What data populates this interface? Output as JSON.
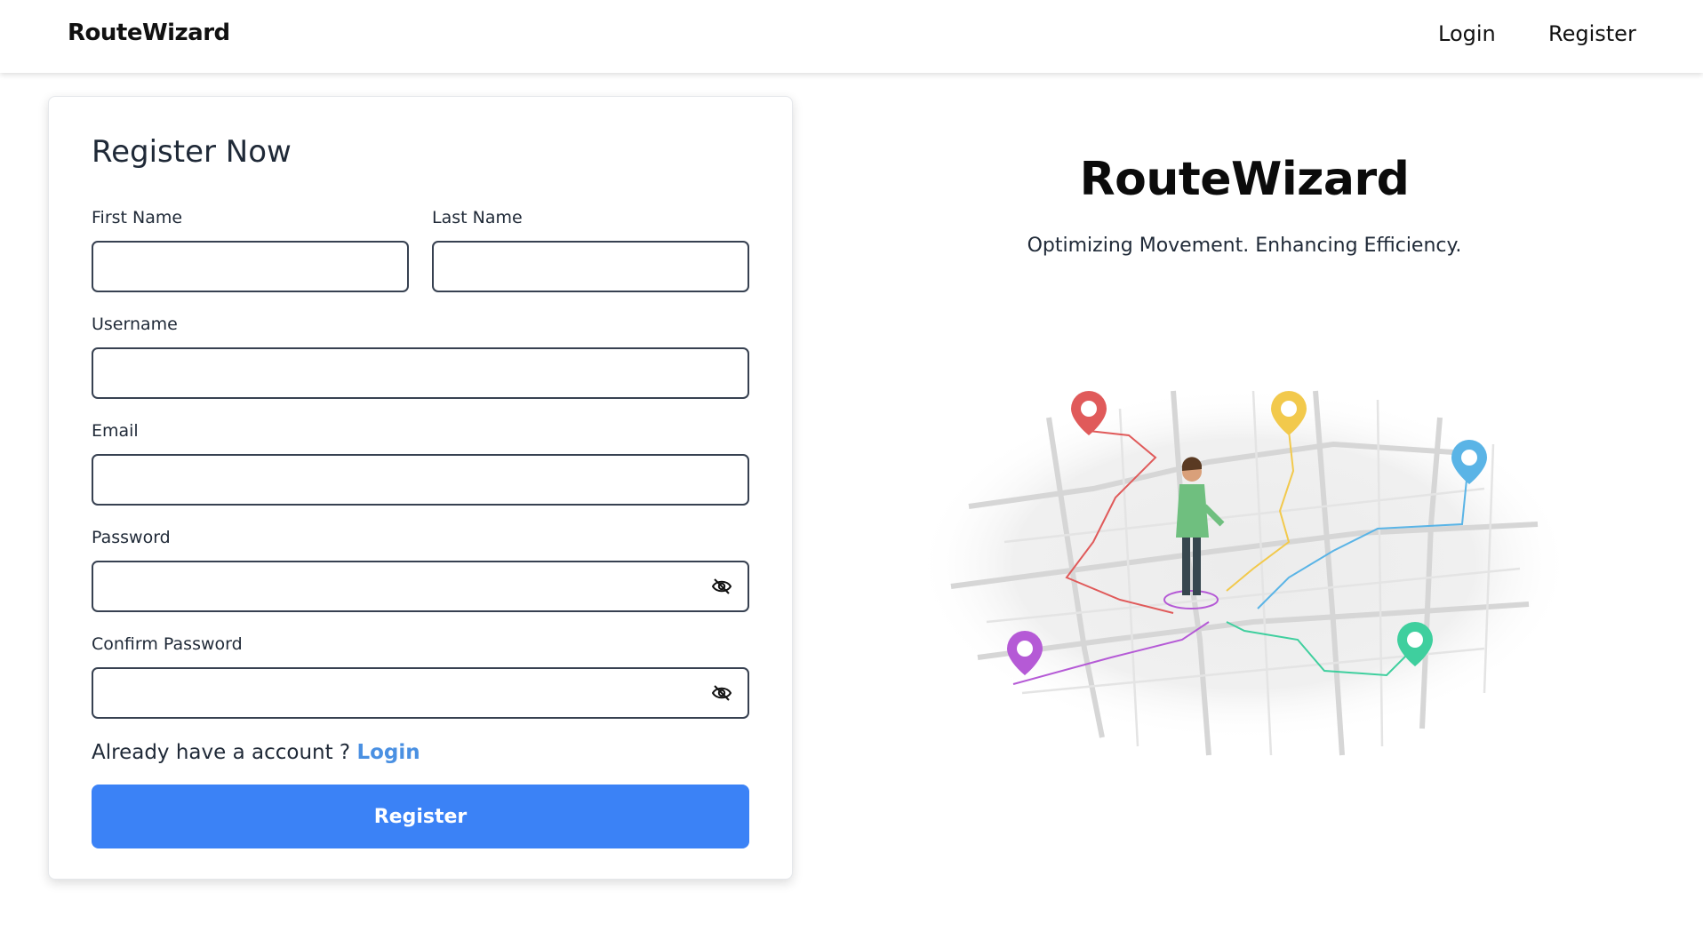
{
  "nav": {
    "brand": "RouteWizard",
    "links": {
      "login": "Login",
      "register": "Register"
    }
  },
  "form": {
    "title": "Register Now",
    "fields": {
      "first_name": {
        "label": "First Name",
        "value": ""
      },
      "last_name": {
        "label": "Last Name",
        "value": ""
      },
      "username": {
        "label": "Username",
        "value": ""
      },
      "email": {
        "label": "Email",
        "value": ""
      },
      "password": {
        "label": "Password",
        "value": ""
      },
      "confirm_password": {
        "label": "Confirm Password",
        "value": ""
      }
    },
    "already_text": "Already have a account ?",
    "login_link": "Login",
    "submit_label": "Register"
  },
  "hero": {
    "title": "RouteWizard",
    "subtitle": "Optimizing Movement. Enhancing Efficiency."
  },
  "illustration": {
    "pins": [
      {
        "icon": "map-pin-icon",
        "color": "#e05a5a"
      },
      {
        "icon": "map-pin-icon",
        "color": "#f2c94c"
      },
      {
        "icon": "map-pin-icon",
        "color": "#5ab4e6"
      },
      {
        "icon": "map-pin-icon",
        "color": "#b55ad6"
      },
      {
        "icon": "map-pin-icon",
        "color": "#3fcf9e"
      }
    ],
    "person_shirt_color": "#6fbf7f"
  },
  "colors": {
    "primary": "#3b82f6",
    "link": "#4a90e2",
    "input_border": "#374151"
  },
  "icons": {
    "password_toggle": "eye-slash-icon"
  }
}
